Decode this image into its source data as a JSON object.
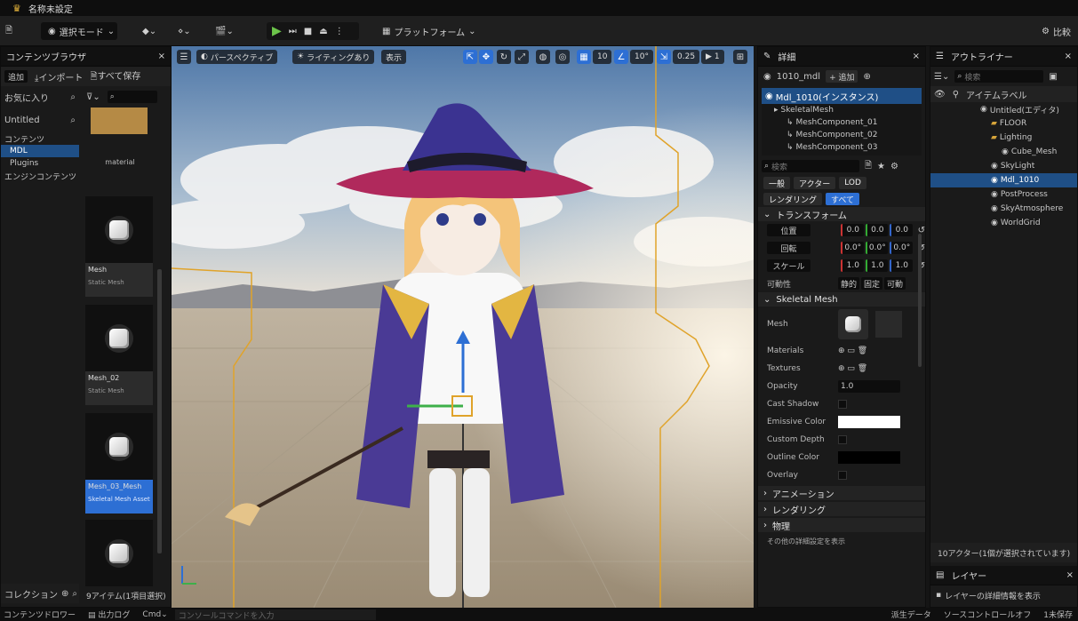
{
  "title": {
    "app_title": "名称未設定"
  },
  "toolbar": {
    "save_icon": "save-icon",
    "mode_label": "選択モード",
    "platforms_label": "プラットフォーム",
    "right_label": "比較"
  },
  "content_browser": {
    "tab_label": "コンテンツブラウザ",
    "add_label": "追加",
    "import_label": "インポート",
    "save_all_label": "すべて保存",
    "favorites_label": "お気に入り",
    "project_label": "Untitled",
    "tree": [
      "コンテンツ",
      "MDL",
      "Plugins",
      "エンジンコンテンツ"
    ],
    "item_count": "9アイテム(1項目選択)",
    "collections_label": "コレクション"
  },
  "assets": [
    {
      "label": "material",
      "sub": ""
    },
    {
      "label": "Mesh",
      "sub": "Static Mesh"
    },
    {
      "label": "Mesh_02",
      "sub": "Static Mesh"
    },
    {
      "label": "Mesh_03_Mesh",
      "sub": "Skeletal Mesh Asset",
      "selected": true
    },
    {
      "label": "",
      "sub": ""
    }
  ],
  "viewport": {
    "perspective_label": "パースペクティブ",
    "lit_label": "ライティングあり",
    "show_label": "表示",
    "grid_value": "10",
    "angle_value": "10°",
    "scale_value": "0.25",
    "camera_speed": "1"
  },
  "details": {
    "tab_label": "詳細",
    "actor_name": "1010_mdl",
    "comp_btn": "+ 追加",
    "instance_label": "Mdl_1010(インスタンス)",
    "children": [
      "SkeletalMesh",
      "MeshComponent_01",
      "MeshComponent_02",
      "MeshComponent_03"
    ],
    "search_placeholder": "検索",
    "filter_tabs": [
      "一般",
      "アクター",
      "LOD",
      "レンダリング",
      "すべて"
    ],
    "transform_label": "トランスフォーム",
    "location_label": "位置",
    "rotation_label": "回転",
    "scale_label": "スケール",
    "mobility_label": "可動性",
    "location_values": [
      "0.0",
      "0.0",
      "0.0"
    ],
    "rotation_values": [
      "0.0°",
      "0.0°",
      "0.0°"
    ],
    "scale_values": [
      "1.0",
      "1.0",
      "1.0"
    ],
    "mobility_values": [
      "静的",
      "固定",
      "可動"
    ],
    "mesh_section": "Skeletal Mesh",
    "mesh_label": "Mesh",
    "rows": [
      "Materials",
      "Textures",
      "Opacity",
      "Cast Shadow",
      "Emissive Color",
      "Custom Depth",
      "Outline Color",
      "Overlay"
    ],
    "opacity_value": "1.0",
    "collapsed_sections": [
      "アニメーション",
      "レンダリング",
      "物理"
    ],
    "bottom_row": "その他の詳細設定を表示"
  },
  "outliner": {
    "tab_label": "アウトライナー",
    "search_placeholder": "検索",
    "col_label": "アイテムラベル",
    "rows": [
      {
        "label": "Untitled(エディタ)",
        "indent": 0
      },
      {
        "label": "FLOOR",
        "indent": 1,
        "folder": true
      },
      {
        "label": "Lighting",
        "indent": 1,
        "folder": true
      },
      {
        "label": "Cube_Mesh",
        "indent": 2
      },
      {
        "label": "SkyLight",
        "indent": 1
      },
      {
        "label": "Mdl_1010",
        "indent": 1,
        "selected": true
      },
      {
        "label": "PostProcess",
        "indent": 1
      },
      {
        "label": "SkyAtmosphere",
        "indent": 1
      },
      {
        "label": "WorldGrid",
        "indent": 1
      }
    ],
    "status": "10アクター(1個が選択されています)",
    "layers_tab": "レイヤー",
    "layers_row": "レイヤーの詳細情報を表示"
  },
  "statusbar": {
    "drawer": "コンテンツドロワー",
    "output": "出力ログ",
    "cmd": "Cmd",
    "cmd_placeholder": "コンソールコマンドを入力",
    "derived": "派生データ",
    "source_control": "ソースコントロールオフ",
    "unsaved": "1未保存"
  },
  "colors": {
    "accent": "#2d6fd4",
    "selection_outline": "#e0a32a"
  }
}
